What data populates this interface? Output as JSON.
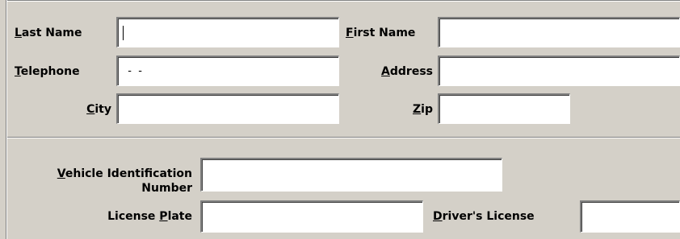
{
  "form": {
    "last_name": {
      "access_key": "L",
      "label_rest": "ast Name",
      "value": ""
    },
    "first_name": {
      "access_key": "F",
      "label_rest": "irst Name",
      "value": ""
    },
    "telephone": {
      "access_key": "T",
      "label_rest": "elephone",
      "value": "  -  -"
    },
    "address": {
      "access_key": "A",
      "label_rest": "ddress",
      "value": ""
    },
    "city": {
      "access_key": "C",
      "label_rest": "ity",
      "value": ""
    },
    "zip": {
      "access_key": "Z",
      "label_rest": "ip",
      "value": ""
    },
    "vin": {
      "access_key": "V",
      "label_line1_rest": "ehicle Identification",
      "label_line2": "Number",
      "value": ""
    },
    "license_plate": {
      "label_prefix": "License ",
      "access_key": "P",
      "label_rest": "late",
      "value": ""
    },
    "drivers_license": {
      "access_key": "D",
      "label_rest": "river's License",
      "value": ""
    }
  },
  "colors": {
    "background": "#d4d0c8",
    "field_background": "#ffffff",
    "shadow": "#808080",
    "highlight": "#ffffff"
  }
}
